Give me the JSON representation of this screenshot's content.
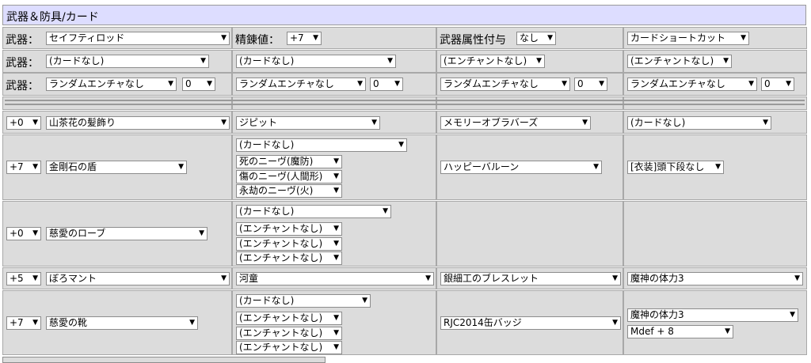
{
  "title": "武器＆防具/カード",
  "row_weapon": {
    "weapon_label": "武器：",
    "weapon_select": "セイフティロッド",
    "refine_label": "精錬値：",
    "refine_select": "+7",
    "element_label": "武器属性付与",
    "element_select": "なし",
    "card_shortcut": "カードショートカット"
  },
  "row_cards": {
    "label": "武器：",
    "c1": "(カードなし)",
    "c2": "(カードなし)",
    "c3": "(エンチャントなし)",
    "c4": "(エンチャントなし)"
  },
  "row_random": {
    "label": "武器：",
    "r1": "ランダムエンチャなし",
    "n1": "0",
    "r2": "ランダムエンチャなし",
    "n2": "0",
    "r3": "ランダムエンチャなし",
    "n3": "0",
    "r4": "ランダムエンチャなし",
    "n4": "0"
  },
  "head": {
    "refine": "+0",
    "item": "山茶花の髪飾り",
    "card": "ジピット",
    "enchant1": "メモリーオブラバーズ",
    "enchant2": "(カードなし)"
  },
  "shield": {
    "refine": "+7",
    "item": "金剛石の盾",
    "card": "(カードなし)",
    "e1": "死のニーヴ(魔防)",
    "e2": "傷のニーヴ(人間形)",
    "e3": "永劫のニーヴ(火)",
    "costume": "ハッピーバルーン",
    "costume2": "[衣装]頭下段なし"
  },
  "armor": {
    "refine": "+0",
    "item": "慈愛のローブ",
    "card": "(カードなし)",
    "e1": "(エンチャントなし)",
    "e2": "(エンチャントなし)",
    "e3": "(エンチャントなし)"
  },
  "garment": {
    "refine": "+5",
    "item": "ぼろマント",
    "card": "河童",
    "acc": "銀細工のブレスレット",
    "acc_enchant": "魔神の体力3"
  },
  "shoes": {
    "refine": "+7",
    "item": "慈愛の靴",
    "card": "(カードなし)",
    "e1": "(エンチャントなし)",
    "e2": "(エンチャントなし)",
    "e3": "(エンチャントなし)",
    "acc": "RJC2014缶バッジ",
    "acc_enchant": "魔神の体力3",
    "acc_extra": "Mdef + 8"
  }
}
